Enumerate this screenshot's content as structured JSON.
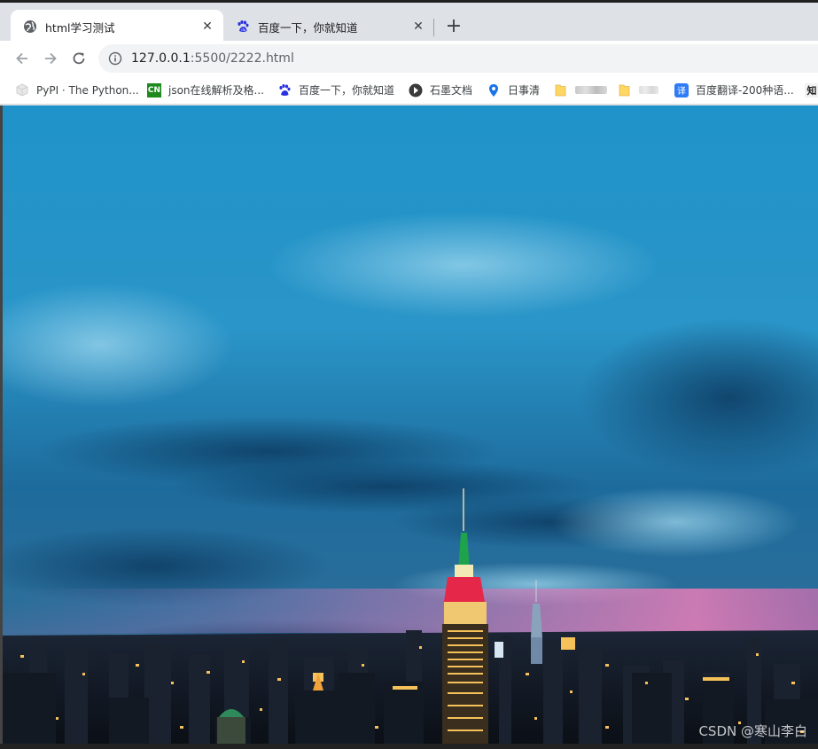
{
  "tabs": [
    {
      "title": "html学习测试",
      "active": true,
      "favicon": "globe-icon"
    },
    {
      "title": "百度一下，你就知道",
      "active": false,
      "favicon": "baidu-paw-icon"
    }
  ],
  "toolbar": {
    "url_host": "127.0.0.1",
    "url_rest": ":5500/2222.html"
  },
  "bookmarks": [
    {
      "label": "PyPI · The Python...",
      "icon": "pypi-cube-icon"
    },
    {
      "label": "json在线解析及格...",
      "icon": "cn-badge-icon",
      "badge": "CN"
    },
    {
      "label": "百度一下，你就知道",
      "icon": "baidu-paw-icon"
    },
    {
      "label": "石墨文档",
      "icon": "shimo-icon"
    },
    {
      "label": "日事清",
      "icon": "location-pin-icon"
    },
    {
      "label": "",
      "icon": "folder-icon"
    },
    {
      "label": "",
      "icon": "folder-icon"
    },
    {
      "label": "百度翻译-200种语...",
      "icon": "translate-icon",
      "badge": "译"
    },
    {
      "label": "",
      "icon": "zhihu-icon",
      "badge": "知"
    }
  ],
  "page": {
    "watermark": "CSDN @寒山李白",
    "image_subject": "skyline-night-photo"
  },
  "colors": {
    "tabstrip": "#dee1e6",
    "omnibox": "#f1f3f4",
    "sky_top": "#1e8fc6",
    "city_lights": "#f5c15a"
  }
}
